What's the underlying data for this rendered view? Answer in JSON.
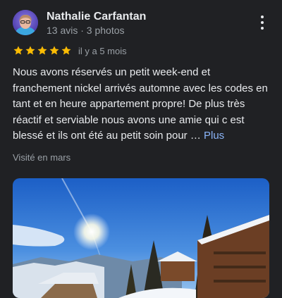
{
  "review": {
    "author_name": "Nathalie Carfantan",
    "author_meta": "13 avis · 3 photos",
    "rating": 5,
    "rating_max": 5,
    "time_ago": "il y a 5 mois",
    "text": "Nous avons réservés un petit week-end et franchement nickel arrivés automne avec les codes en tant et en heure appartement propre! De plus très réactif et serviable nous avons une amie qui c est blessé et ils ont été au petit soin pour … ",
    "more_label": "Plus",
    "visited": "Visité en mars"
  },
  "icons": {
    "avatar": "avatar",
    "menu": "more-vert-icon",
    "star": "star-icon"
  },
  "colors": {
    "background": "#202124",
    "star": "#fbbc04",
    "link": "#8ab4f8",
    "secondary_text": "#9aa0a6"
  }
}
